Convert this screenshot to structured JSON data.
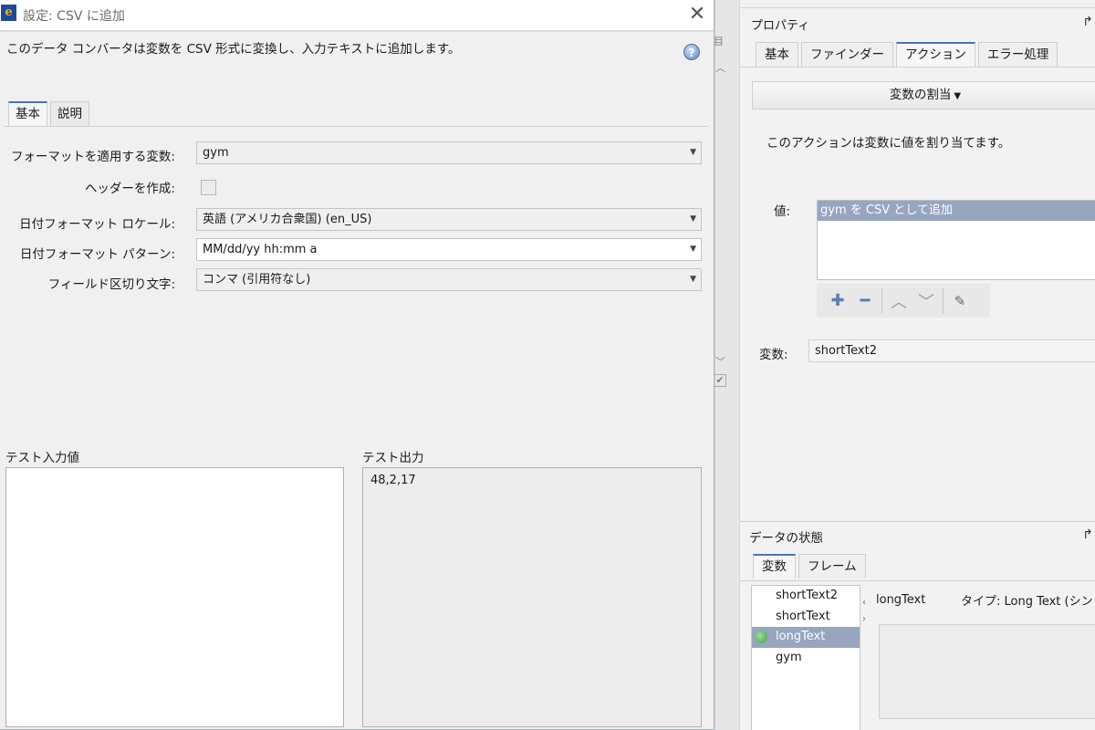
{
  "dialog": {
    "title": "設定: CSV に追加",
    "description": "このデータ コンバータは変数を CSV 形式に変換し、入力テキストに追加します。",
    "tabs": [
      "基本",
      "説明"
    ],
    "fields": {
      "variable_label": "フォーマットを適用する変数:",
      "variable_value": "gym",
      "header_label": "ヘッダーを作成:",
      "header_checked": false,
      "locale_label": "日付フォーマット ロケール:",
      "locale_value": "英語 (アメリカ合衆国) (en_US)",
      "pattern_label": "日付フォーマット パターン:",
      "pattern_value": "MM/dd/yy hh:mm a",
      "delimiter_label": "フィールド区切り文字:",
      "delimiter_value": "コンマ (引用符なし)"
    },
    "test_input_label": "テスト入力値",
    "test_input_value": "",
    "test_output_label": "テスト出力",
    "test_output_value": "48,2,17"
  },
  "properties": {
    "title": "プロパティ",
    "tabs": [
      "基本",
      "ファインダー",
      "アクション",
      "エラー処理"
    ],
    "active_tab": "アクション",
    "action_button": "変数の割当",
    "action_description": "このアクションは変数に値を割り当てます。",
    "value_label": "値:",
    "value_items": [
      "gym を CSV として追加"
    ],
    "variable_label": "変数:",
    "variable_value": "shortText2"
  },
  "data_state": {
    "title": "データの状態",
    "tabs": [
      "変数",
      "フレーム"
    ],
    "variables": [
      "shortText2",
      "shortText",
      "longText",
      "gym"
    ],
    "selected": "longText",
    "detail_name": "longText",
    "detail_type": "タイプ: Long Text (シン"
  },
  "colors": {
    "accent": "#4b74b5",
    "selection": "#97a5bf"
  }
}
